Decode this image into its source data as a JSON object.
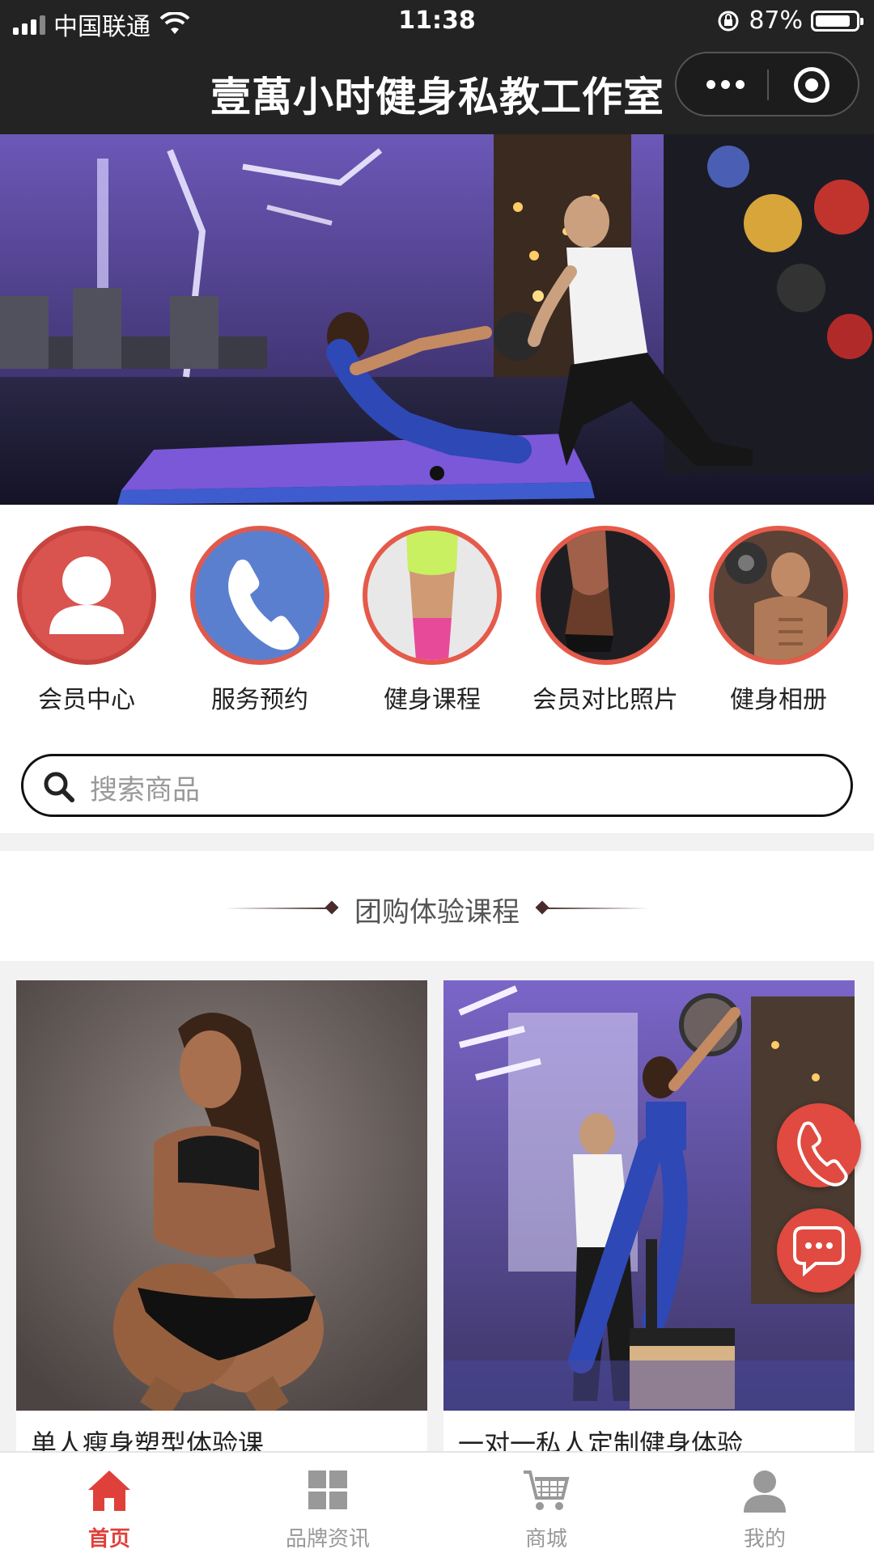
{
  "status_bar": {
    "carrier": "中国联通",
    "time": "11:38",
    "battery": "87%",
    "battery_level": 0.87
  },
  "nav": {
    "title": "壹萬小时健身私教工作室"
  },
  "banner": {
    "total_slides": 1,
    "active_slide": 1
  },
  "quick_menu": {
    "items": [
      {
        "label": "会员中心",
        "icon": "user-icon",
        "color": "#d9534f"
      },
      {
        "label": "服务预约",
        "icon": "phone-icon",
        "color": "#5b7fcf"
      },
      {
        "label": "健身课程",
        "icon": "fitness-course-photo",
        "color": "#e55a4a"
      },
      {
        "label": "会员对比照片",
        "icon": "member-compare-photo",
        "color": "#e55a4a"
      },
      {
        "label": "健身相册",
        "icon": "fitness-album-photo",
        "color": "#e55a4a"
      }
    ]
  },
  "search": {
    "placeholder": "搜索商品"
  },
  "section": {
    "title": "团购体验课程"
  },
  "products": [
    {
      "name": "单人瘦身塑型体验课"
    },
    {
      "name": "一对一私人定制健身体验"
    }
  ],
  "fabs": {
    "call_icon": "phone-icon",
    "chat_icon": "chat-icon",
    "color": "#e04a40"
  },
  "tabbar": {
    "items": [
      {
        "label": "首页",
        "icon": "home-icon",
        "active": true
      },
      {
        "label": "品牌资讯",
        "icon": "grid-icon",
        "active": false
      },
      {
        "label": "商城",
        "icon": "cart-icon",
        "active": false
      },
      {
        "label": "我的",
        "icon": "profile-icon",
        "active": false
      }
    ],
    "active_color": "#e0403a"
  }
}
